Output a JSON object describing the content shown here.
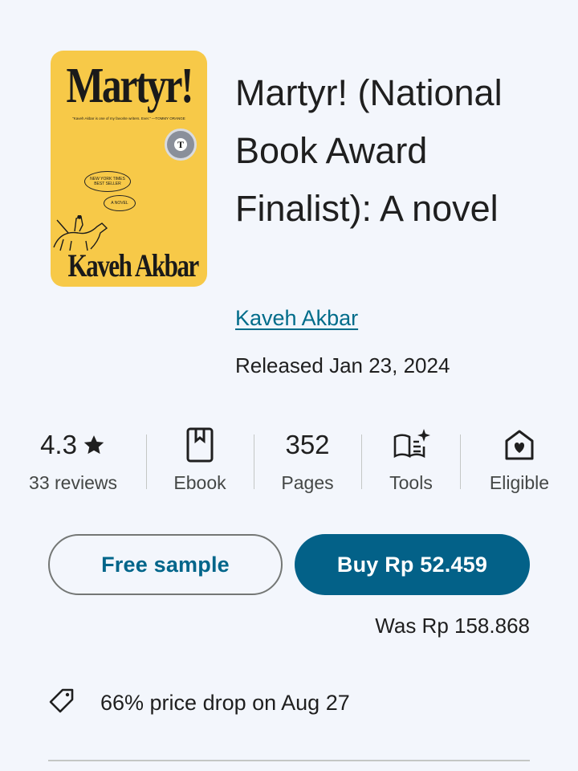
{
  "book": {
    "cover": {
      "title": "Martyr!",
      "blurb": "\"Kaveh Akbar is one of my favorite writers. Ever.\" —TOMMY ORANGE",
      "bubble_bestseller": "NEW YORK TIMES BEST SELLER",
      "bubble_novel": "A NOVEL",
      "seal_letter": "T",
      "author": "Kaveh Akbar",
      "background_color": "#f7c948"
    },
    "title": "Martyr! (National Book Award Finalist): A novel",
    "author": "Kaveh Akbar",
    "released": "Released Jan 23, 2024"
  },
  "stats": {
    "rating": {
      "value": "4.3",
      "icon": "star-icon",
      "label": "33 reviews"
    },
    "format": {
      "icon": "ebook-icon",
      "label": "Ebook"
    },
    "pages": {
      "value": "352",
      "label": "Pages"
    },
    "tools": {
      "icon": "tools-book-sparkle-icon",
      "label": "Tools"
    },
    "eligible": {
      "icon": "family-library-icon",
      "label": "Eligible"
    }
  },
  "actions": {
    "sample_label": "Free sample",
    "buy_label": "Buy Rp 52.459",
    "was_price": "Was Rp 158.868"
  },
  "price_drop": {
    "icon": "tag-icon",
    "text": "66% price drop on Aug 27"
  },
  "colors": {
    "background": "#f3f6fc",
    "accent": "#036188",
    "link": "#006c8a"
  }
}
